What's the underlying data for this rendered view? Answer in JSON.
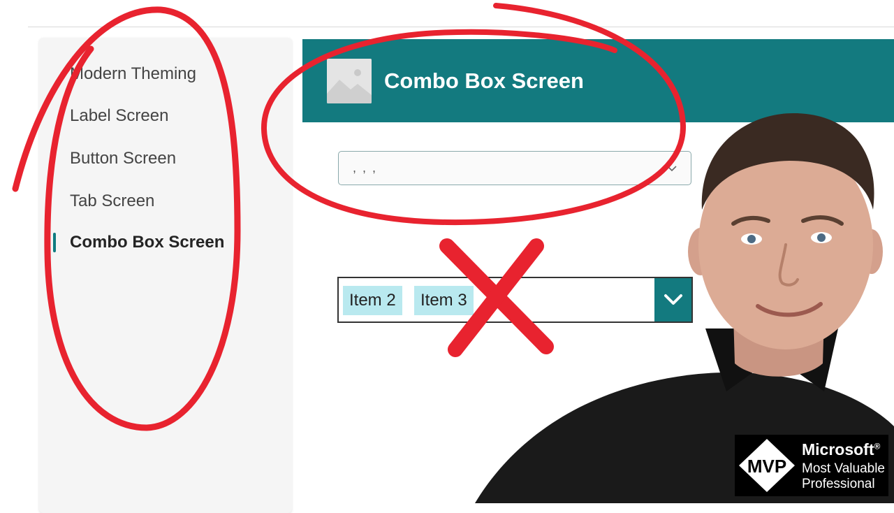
{
  "sidebar": {
    "items": [
      {
        "label": "Modern Theming"
      },
      {
        "label": "Label Screen"
      },
      {
        "label": "Button Screen"
      },
      {
        "label": "Tab Screen"
      },
      {
        "label": "Combo Box Screen",
        "selected": true
      }
    ]
  },
  "header": {
    "title": "Combo Box Screen",
    "image_icon": "image-placeholder-icon"
  },
  "modern_combobox": {
    "value": ", , ,",
    "icon": "chevron-down-icon"
  },
  "classic_combobox": {
    "selected_items": [
      "Item 2",
      "Item 3"
    ],
    "icon": "chevron-down-icon"
  },
  "badge": {
    "logo_text": "MVP",
    "brand": "Microsoft",
    "trademark": "®",
    "line2": "Most Valuable",
    "line3": "Professional"
  },
  "colors": {
    "accent": "#137a7f",
    "chip": "#b9e9ef",
    "annotation": "#e8232f"
  }
}
